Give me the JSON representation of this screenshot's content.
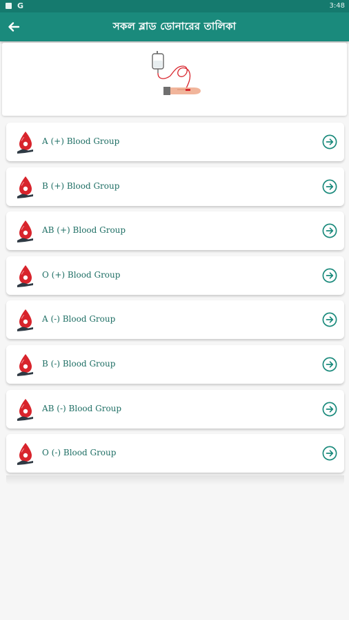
{
  "status_bar": {
    "google_label": "G",
    "time": "3:48"
  },
  "app_bar": {
    "title": "সকল ব্লাড ডোনারের তালিকা",
    "back_icon": "arrow-left-icon"
  },
  "header_card": {
    "image": "blood-donation-illustration"
  },
  "colors": {
    "primary": "#1a8a7c",
    "status_bar": "#157a6e",
    "label_text": "#1e6e64",
    "blood_red": "#d8242c"
  },
  "blood_groups": [
    {
      "label": "A (+) Blood Group",
      "icon": "blood-drop-hand-icon",
      "action_icon": "arrow-right-circle-icon"
    },
    {
      "label": "B (+) Blood Group",
      "icon": "blood-drop-hand-icon",
      "action_icon": "arrow-right-circle-icon"
    },
    {
      "label": "AB (+) Blood Group",
      "icon": "blood-drop-hand-icon",
      "action_icon": "arrow-right-circle-icon"
    },
    {
      "label": "O (+) Blood Group",
      "icon": "blood-drop-hand-icon",
      "action_icon": "arrow-right-circle-icon"
    },
    {
      "label": "A (-) Blood Group",
      "icon": "blood-drop-hand-icon",
      "action_icon": "arrow-right-circle-icon"
    },
    {
      "label": "B (-) Blood Group",
      "icon": "blood-drop-hand-icon",
      "action_icon": "arrow-right-circle-icon"
    },
    {
      "label": "AB (-) Blood Group",
      "icon": "blood-drop-hand-icon",
      "action_icon": "arrow-right-circle-icon"
    },
    {
      "label": "O (-) Blood Group",
      "icon": "blood-drop-hand-icon",
      "action_icon": "arrow-right-circle-icon"
    }
  ]
}
